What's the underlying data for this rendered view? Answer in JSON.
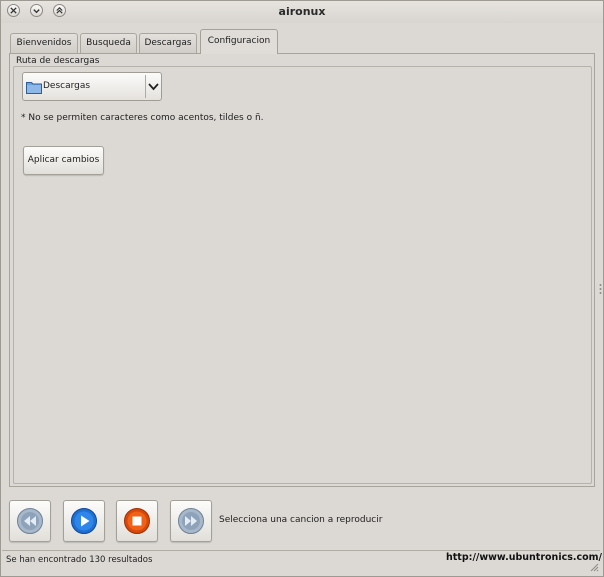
{
  "window": {
    "title": "aironux"
  },
  "tabs": [
    {
      "label": "Bienvenidos",
      "active": false
    },
    {
      "label": "Busqueda",
      "active": false
    },
    {
      "label": "Descargas",
      "active": false
    },
    {
      "label": "Configuracion",
      "active": true
    }
  ],
  "config": {
    "group_label": "Ruta de descargas",
    "folder_selected": "Descargas",
    "note": "* No se permiten caracteres como acentos, tildes o ñ.",
    "apply_label": "Aplicar cambios"
  },
  "player": {
    "buttons": [
      "rewind-icon",
      "play-icon",
      "stop-icon",
      "fast-forward-icon"
    ],
    "now_playing": "Selecciona una cancion a reproducir"
  },
  "status": {
    "message": "Se han encontrado 130 resultados",
    "link": "http://www.ubuntronics.com/"
  },
  "colors": {
    "background": "#dcd9d4",
    "play_blue": "#1f6fd1",
    "stop_orange": "#e2530d",
    "inactive_gray": "#8aa0b8"
  }
}
